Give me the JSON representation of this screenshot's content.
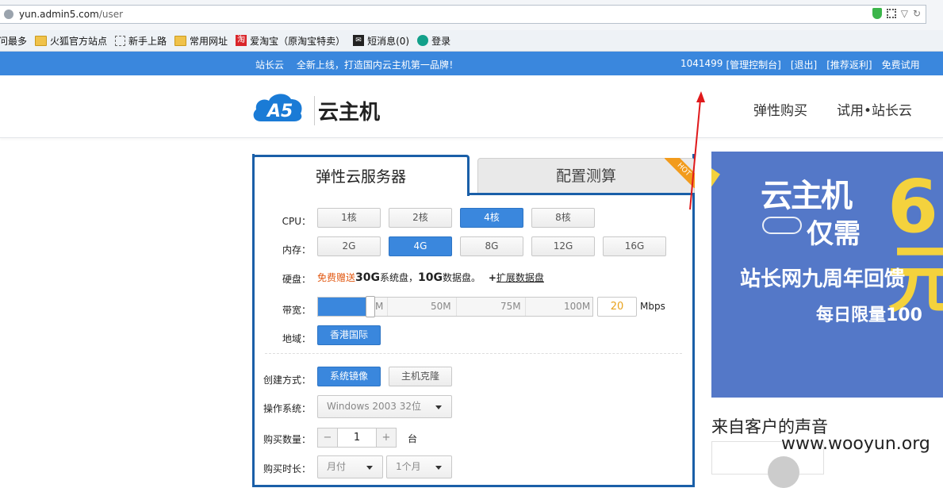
{
  "browser": {
    "url_host": "yun.admin5.com",
    "url_path": "/user",
    "bookmarks": [
      {
        "label": "访问最多",
        "icon": "none"
      },
      {
        "label": "火狐官方站点",
        "icon": "folder-icon"
      },
      {
        "label": "新手上路",
        "icon": "dashed-page-icon"
      },
      {
        "label": "常用网址",
        "icon": "folder-icon"
      },
      {
        "label": "爱淘宝（原淘宝特卖）",
        "icon": "taobao-icon"
      },
      {
        "label": "短消息(0)",
        "icon": "message-icon"
      },
      {
        "label": "登录",
        "icon": "login-icon"
      }
    ],
    "taobao_glyph": "淘",
    "message_glyph": "✉"
  },
  "topbar": {
    "brand": "站长云",
    "slogan": "全新上线，打造国内云主机第一品牌！",
    "user_id": "1041499",
    "links": [
      "[管理控制台]",
      "[退出]",
      "[推荐返利]",
      "免费试用"
    ]
  },
  "header": {
    "logo_letters": "A5",
    "logo_text": "云主机",
    "nav": [
      "弹性购买",
      "试用•站长云"
    ]
  },
  "tabs": {
    "active": "弹性云服务器",
    "inactive": "配置测算",
    "hot": "HOT"
  },
  "form": {
    "cpu_label": "CPU：",
    "cpu_options": [
      "1核",
      "2核",
      "4核",
      "8核"
    ],
    "cpu_selected": "4核",
    "mem_label": "内存：",
    "mem_options": [
      "2G",
      "4G",
      "8G",
      "12G",
      "16G"
    ],
    "mem_selected": "4G",
    "disk_label": "硬盘：",
    "disk_free": "免费赠送",
    "disk_sys_size": "30G",
    "disk_sys_text": "系统盘，",
    "disk_data_size": "10G",
    "disk_data_text": "数据盘。",
    "disk_expand": "扩展数据盘",
    "bw_label": "带宽：",
    "bw_ticks": [
      "M",
      "50M",
      "75M",
      "100M"
    ],
    "bw_value": "20",
    "bw_unit": "Mbps",
    "bw_level_fraction": 0.2,
    "region_label": "地域：",
    "region_value": "香港国际",
    "create_label": "创建方式：",
    "create_options": [
      "系统镜像",
      "主机克隆"
    ],
    "os_label": "操作系统：",
    "os_value": "Windows 2003 32位",
    "qty_label": "购买数量：",
    "qty_value": "1",
    "qty_minus": "−",
    "qty_plus": "+",
    "qty_unit": "台",
    "duration_label": "购买时长：",
    "duration_type": "月付",
    "duration_value": "1个月"
  },
  "banner": {
    "line1": "云主机",
    "line2": "仅需",
    "big": "6元",
    "line3": "站长网九周年回馈",
    "line4": "每日限量100"
  },
  "side": {
    "voice_title": "来自客户的声音"
  },
  "watermark": "www.wooyun.org",
  "colors": {
    "accent": "#3a87dd",
    "panel_border": "#1a5fa8",
    "hot": "#f29b1c",
    "banner_bg": "#5478c8",
    "banner_yellow": "#f4d23d",
    "annotation_arrow": "#e0191b"
  }
}
